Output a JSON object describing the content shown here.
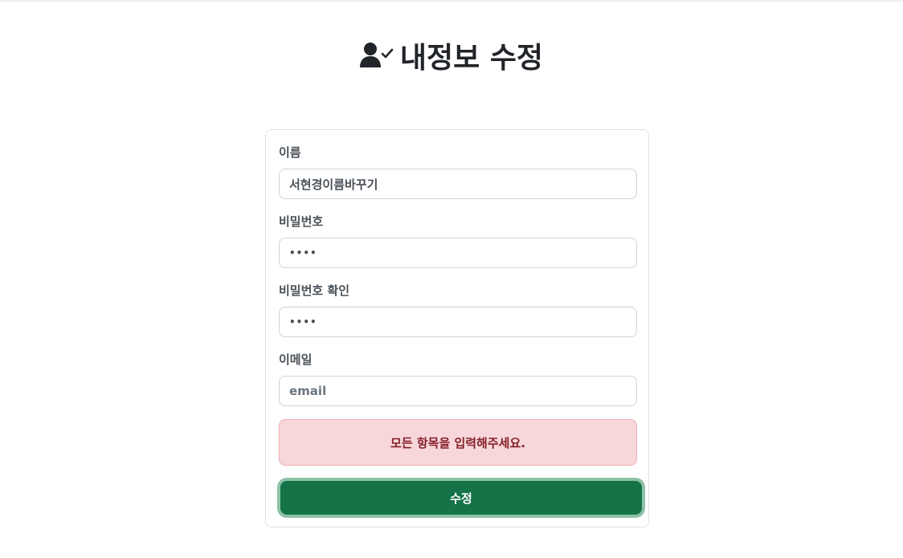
{
  "page": {
    "title": "내정보 수정",
    "title_icon": "user-check-icon"
  },
  "form": {
    "name": {
      "label": "이름",
      "value": "서현경이름바꾸기"
    },
    "password": {
      "label": "비밀번호",
      "value": "1234"
    },
    "password_confirm": {
      "label": "비밀번호 확인",
      "value": "1234"
    },
    "email": {
      "label": "이메일",
      "value": "",
      "placeholder": "email"
    },
    "alert": {
      "message": "모든 항목을 입력해주세요."
    },
    "submit_label": "수정"
  },
  "colors": {
    "primary_button": "#157347",
    "alert_background": "#f8d7da",
    "alert_text": "#842029"
  }
}
